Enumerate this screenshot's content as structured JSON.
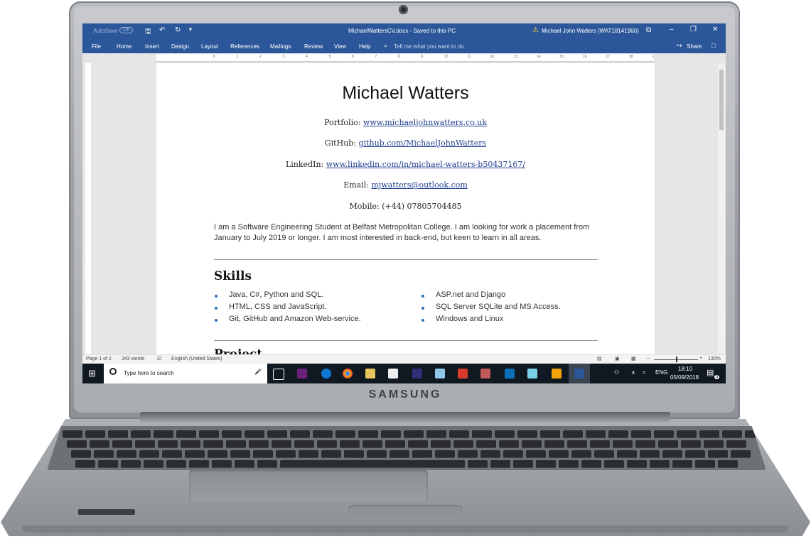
{
  "laptop": {
    "brand": "SAMSUNG"
  },
  "word": {
    "autosave_label": "AutoSave",
    "autosave_state": "Off",
    "document_title": "MichaelWattersCV.docx  -  Saved to this PC",
    "user_name": "Michael John Watters (WAT18141960)",
    "ribbon_tabs": [
      "File",
      "Home",
      "Insert",
      "Design",
      "Layout",
      "References",
      "Mailings",
      "Review",
      "View",
      "Help"
    ],
    "tell_me_placeholder": "Tell me what you want to do",
    "share_label": "Share",
    "status": {
      "page": "Page 1 of 2",
      "words": "343 words",
      "language": "English (United States)",
      "zoom": "130%"
    }
  },
  "document": {
    "name": "Michael Watters",
    "portfolio_label": "Portfolio: ",
    "portfolio_link": "www.michaeljohnwatters.co.uk",
    "github_label": "GitHub: ",
    "github_link": "github.com/MichaelJohnWatters",
    "linkedin_label": "LinkedIn: ",
    "linkedin_link": "www.linkedin.com/in/michael-watters-b50437167/",
    "email_label": "Email: ",
    "email_link": "mjwatters@outlook.com",
    "mobile": "Mobile: (+44) 07805704485",
    "summary": "I am a Software Engineering Student at Belfast Metropolitan College. I am looking for work a placement from January to July 2019 or longer. I am most interested in back-end, but keen to learn in all areas.",
    "skills_heading": "Skills",
    "skills_left": [
      "Java, C#, Python and SQL.",
      "HTML, CSS and JavaScript.",
      "Git, GitHub and Amazon Web-service."
    ],
    "skills_right": [
      "ASP.net and Django",
      "SQL Server SQLite and MS Access.",
      "Windows and Linux"
    ],
    "next_heading_partial": "Project"
  },
  "taskbar": {
    "search_placeholder": "Type here to search",
    "language": "ENG",
    "time": "18:10",
    "date": "05/09/2018",
    "notification_count": "3"
  },
  "colors": {
    "word_blue": "#2b579a",
    "link_blue": "#1f3f8f",
    "bullet_blue": "#2e6fb7",
    "taskbar": "#101821"
  }
}
